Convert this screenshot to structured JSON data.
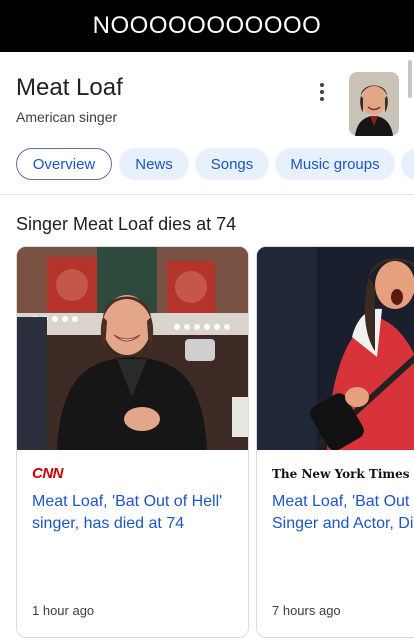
{
  "caption": "NOOOOOOOOOOO",
  "entity": {
    "title": "Meat Loaf",
    "subtitle": "American singer"
  },
  "chips": [
    {
      "label": "Overview",
      "active": true
    },
    {
      "label": "News",
      "active": false
    },
    {
      "label": "Songs",
      "active": false
    },
    {
      "label": "Music groups",
      "active": false
    }
  ],
  "section": {
    "title": "Singer Meat Loaf dies at 74"
  },
  "cards": [
    {
      "source": "CNN",
      "headline_line1": "Meat Loaf, 'Bat Out of Hell'",
      "headline_line2": "singer, has died at 74",
      "time": "1 hour ago"
    },
    {
      "source": "The New York Times",
      "headline_line1": "Meat Loaf, 'Bat Out",
      "headline_line2": "Singer and Actor, Di",
      "time": "7 hours ago"
    }
  ],
  "colors": {
    "link_blue": "#1a56c7",
    "chip_bg": "#e8f0fe",
    "cnn_red": "#cc0000"
  }
}
